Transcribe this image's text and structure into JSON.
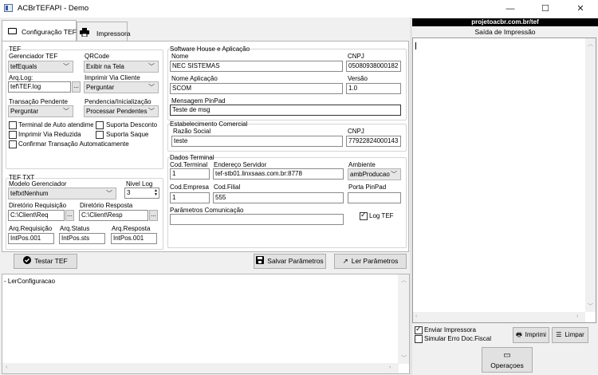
{
  "window": {
    "title": "ACBrTEFAPI - Demo",
    "minimize": "—",
    "maximize": "☐",
    "close": "✕"
  },
  "tabs": [
    {
      "label": "Configuração TEF",
      "icon": "card-icon"
    },
    {
      "label": "Impressora",
      "icon": "printer-icon"
    }
  ],
  "tef": {
    "title": "TEF",
    "gerenciador_label": "Gerenciador TEF",
    "gerenciador_value": "tefEquals",
    "qrcode_label": "QRCode",
    "qrcode_value": "Exibir na Tela",
    "arqlog_label": "Arq.Log:",
    "arqlog_value": "tef\\TEF.log",
    "imprimir_via_label": "Imprimir Via Cliente",
    "imprimir_via_value": "Perguntar",
    "transacao_label": "Transação Pendente",
    "transacao_value": "Perguntar",
    "pendencia_label": "Pendencia/Inicialização",
    "pendencia_value": "Processar Pendentes",
    "checks": {
      "terminal_auto": "Terminal de Auto atendimento",
      "suporta_desconto": "Suporta Desconto",
      "imprimir_reduzida": "Imprimir Via Reduzida",
      "suporta_saque": "Suporta Saque",
      "confirmar_auto": "Confirmar Transação Automaticamente"
    }
  },
  "tef_txt": {
    "title": "TEF TXT",
    "modelo_label": "Modelo Gerenciador",
    "modelo_value": "teftxtNenhum",
    "nivel_label": "Nivel Log",
    "nivel_value": "3",
    "dir_req_label": "Diretório Requisição",
    "dir_req_value": "C:\\Client\\Req",
    "dir_resp_label": "Diretório Resposta",
    "dir_resp_value": "C:\\Client\\Resp",
    "arq_req_label": "Arq.Requisição",
    "arq_req_value": "IntPos.001",
    "arq_status_label": "Arq.Status",
    "arq_status_value": "IntPos.sts",
    "arq_resp_label": "Arq.Resposta",
    "arq_resp_value": "IntPos.001"
  },
  "software_house": {
    "title": "Software House e Aplicação",
    "nome_label": "Nome",
    "nome_value": "NEC SISTEMAS",
    "cnpj_label": "CNPJ",
    "cnpj_value": "05080938000182",
    "nome_app_label": "Nome Aplicação",
    "nome_app_value": "SCOM",
    "versao_label": "Versão",
    "versao_value": "1.0",
    "msg_label": "Mensagem PinPad",
    "msg_value": "Teste de msg"
  },
  "estabelecimento": {
    "title": "Estabelecimento Comercial",
    "razao_label": "Razão Social",
    "razao_value": "teste",
    "cnpj_label": "CNPJ",
    "cnpj_value": "77922824000143"
  },
  "dados_terminal": {
    "title": "Dados Terminal",
    "cod_terminal_label": "Cod.Terminal",
    "cod_terminal_value": "1",
    "endereco_label": "Endereço Servidor",
    "endereco_value": "tef-stb01.linxsaas.com.br:8778",
    "ambiente_label": "Ambiente",
    "ambiente_value": "ambProducao",
    "cod_empresa_label": "Cod.Empresa",
    "cod_empresa_value": "1",
    "cod_filial_label": "Cod.Filial",
    "cod_filial_value": "555",
    "porta_label": "Porta PinPad",
    "porta_value": "",
    "parametros_label": "Parâmetros Comunicação",
    "parametros_value": "",
    "logtef_label": "Log TEF"
  },
  "buttons": {
    "testar": "Testar TEF",
    "salvar": "Salvar Parâmetros",
    "ler": "Ler Parâmetros"
  },
  "log": {
    "line1": "- LerConfiguracao"
  },
  "right_panel": {
    "site": "projetoacbr.com.br/tef",
    "saida_title": "Saída de Impressão",
    "enviar_label": "Enviar Impressora",
    "simular_label": "Simular Erro Doc.Fiscal",
    "imprimir_label": "Imprimi",
    "limpar_label": "Limpar",
    "operacoes_label": "Operaçoes"
  }
}
